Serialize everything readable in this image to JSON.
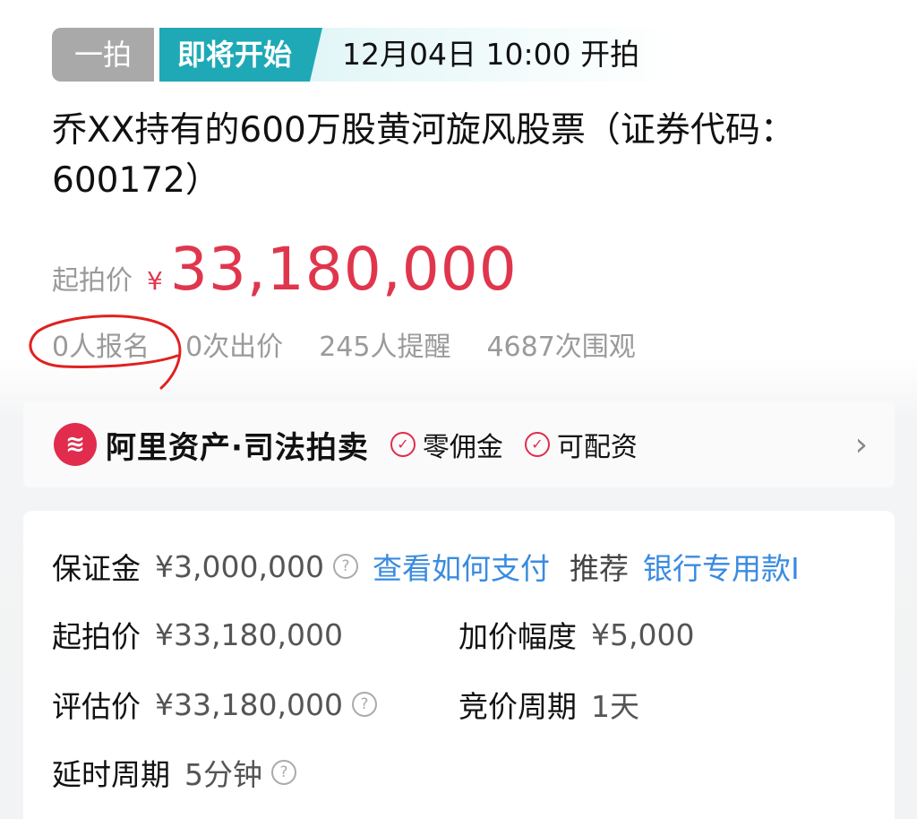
{
  "header": {
    "round_tag": "一拍",
    "status_tag": "即将开始",
    "start_time": "12月04日 10:00 开拍"
  },
  "lot": {
    "title": "乔XX持有的600万股黄河旋风股票（证券代码：600172）"
  },
  "price": {
    "label": "起拍价",
    "currency": "¥",
    "value": "33,180,000"
  },
  "stats": {
    "signups": "0人报名",
    "bids": "0次出价",
    "reminders": "245人提醒",
    "views": "4687次围观"
  },
  "platform": {
    "name": "阿里资产·司法拍卖",
    "badges": [
      "零佣金",
      "可配资"
    ],
    "brand_color": "#e22c4d"
  },
  "details": {
    "deposit_label": "保证金",
    "deposit_value": "¥3,000,000",
    "pay_link": "查看如何支付",
    "recommend_label": "推荐",
    "recommend_link": "银行专用款I",
    "start_price_label": "起拍价",
    "start_price_value": "¥33,180,000",
    "increment_label": "加价幅度",
    "increment_value": "¥5,000",
    "appraisal_label": "评估价",
    "appraisal_value": "¥33,180,000",
    "bid_period_label": "竞价周期",
    "bid_period_value": "1天",
    "delay_label": "延时周期",
    "delay_value": "5分钟"
  },
  "colors": {
    "accent_teal": "#1fa9b7",
    "price_red": "#e0364d",
    "link_blue": "#3a8be0"
  }
}
